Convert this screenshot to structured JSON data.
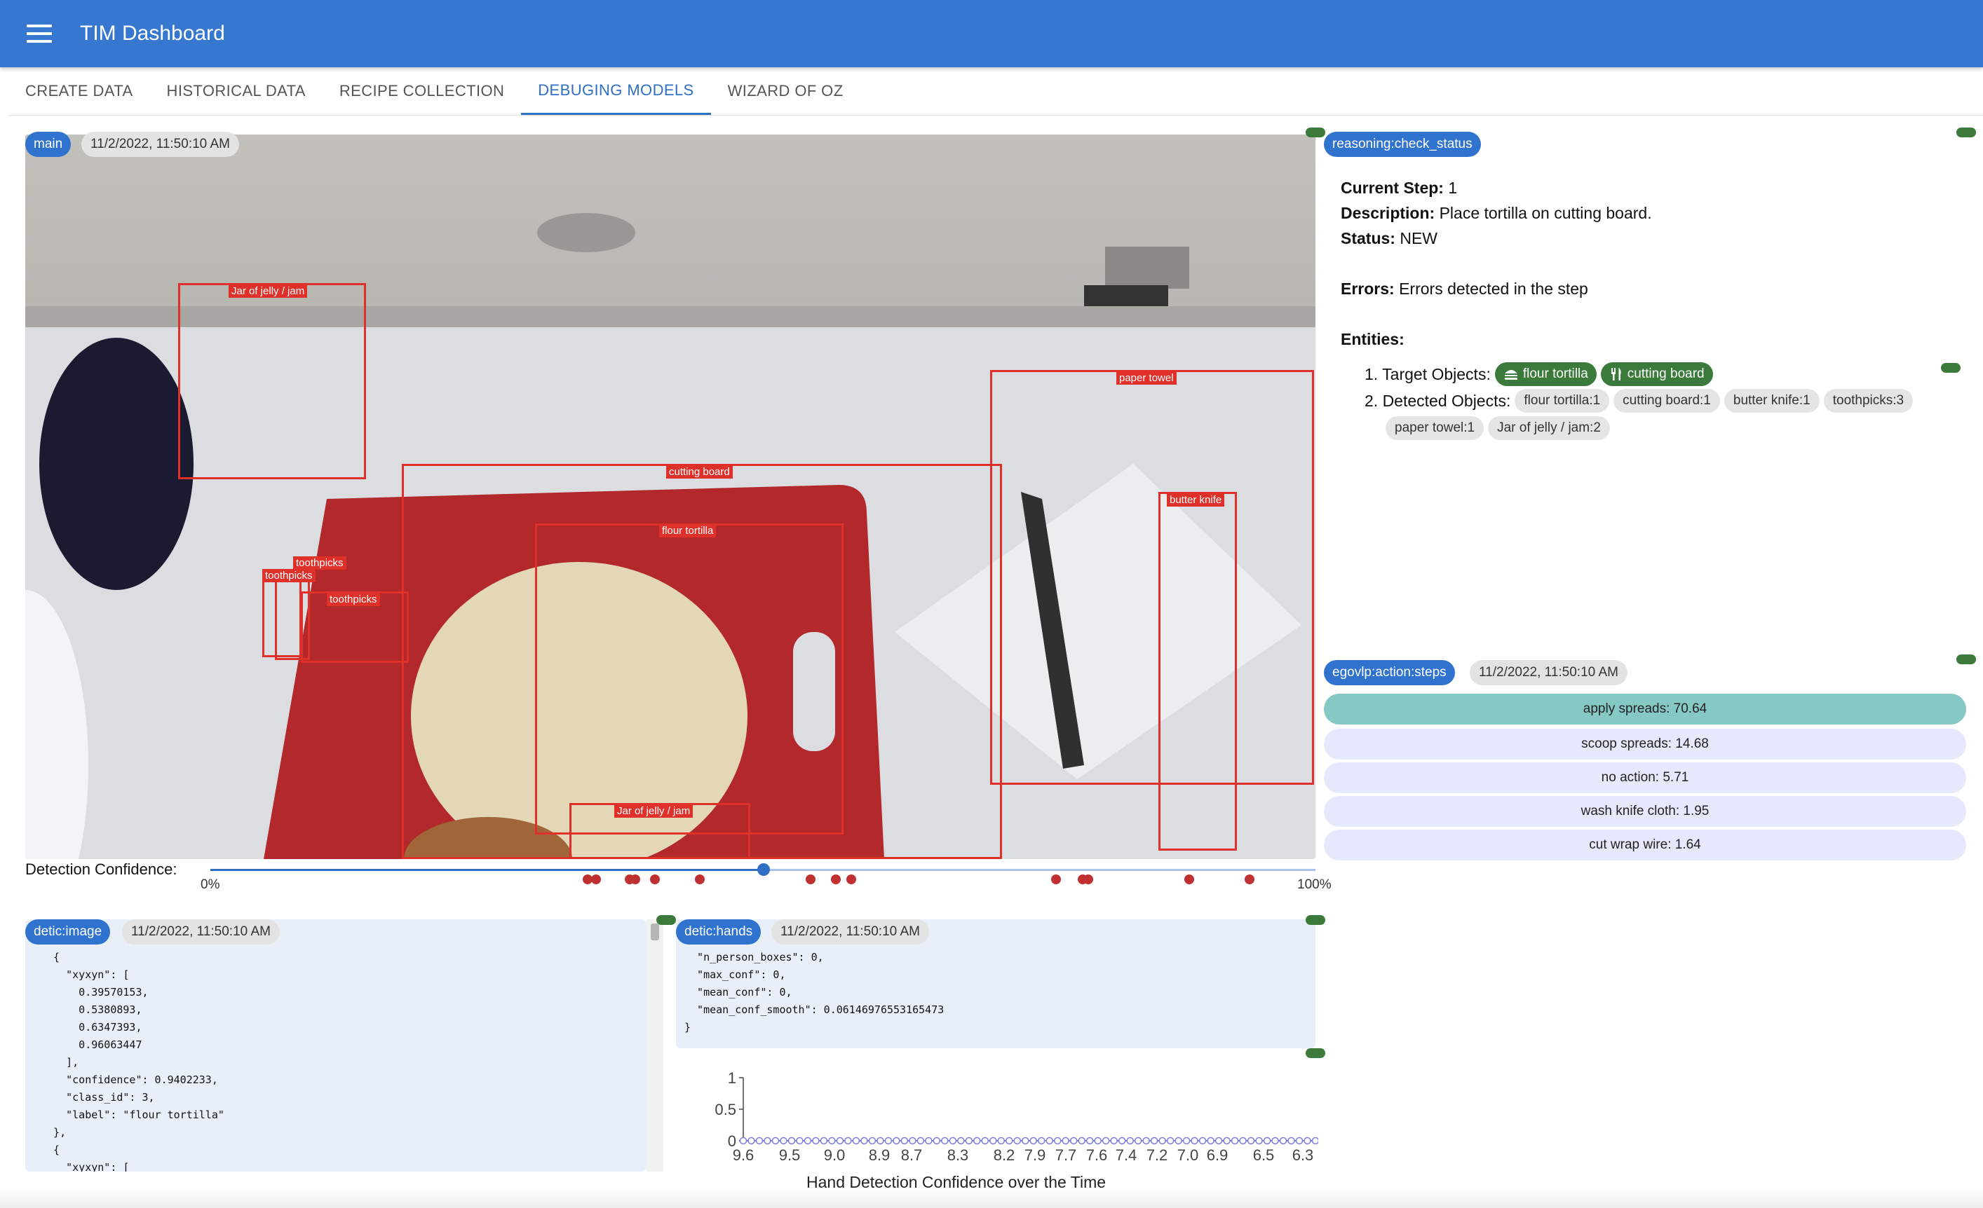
{
  "app": {
    "title": "TIM Dashboard"
  },
  "tabs": [
    {
      "label": "CREATE DATA"
    },
    {
      "label": "HISTORICAL DATA"
    },
    {
      "label": "RECIPE COLLECTION"
    },
    {
      "label": "DEBUGING MODELS"
    },
    {
      "label": "WIZARD OF OZ"
    }
  ],
  "main": {
    "stream": "main",
    "timestamp": "11/2/2022, 11:50:10 AM",
    "detections": [
      {
        "label": "Jar of jelly / jam"
      },
      {
        "label": "paper towel"
      },
      {
        "label": "cutting board"
      },
      {
        "label": "butter knife"
      },
      {
        "label": "flour tortilla"
      },
      {
        "label": "toothpicks"
      },
      {
        "label": "toothpicks"
      },
      {
        "label": "toothpicks"
      },
      {
        "label": "Jar of jelly / jam"
      }
    ],
    "confidence_label": "Detection Confidence:",
    "slider_min": "0%",
    "slider_max": "100%",
    "slider_value": 0.5
  },
  "reasoning": {
    "stream": "reasoning:check_status",
    "current_step_label": "Current Step:",
    "current_step": "1",
    "description_label": "Description:",
    "description": "Place tortilla on cutting board.",
    "status_label": "Status:",
    "status": "NEW",
    "errors_label": "Errors:",
    "errors": "Errors detected in the step",
    "entities_label": "Entities:",
    "target_label": "1. Target Objects:",
    "target_objects": [
      "flour tortilla",
      "cutting board"
    ],
    "detected_label": "2. Detected Objects:",
    "detected_objects": [
      "flour tortilla:1",
      "cutting board:1",
      "butter knife:1",
      "toothpicks:3",
      "paper towel:1",
      "Jar of jelly / jam:2"
    ]
  },
  "egovlp": {
    "stream": "egovlp:action:steps",
    "timestamp": "11/2/2022, 11:50:10 AM",
    "actions": [
      "apply spreads: 70.64",
      "scoop spreads: 14.68",
      "no action: 5.71",
      "wash knife cloth: 1.95",
      "cut wrap wire: 1.64"
    ]
  },
  "detic_image": {
    "stream": "detic:image",
    "timestamp": "11/2/2022, 11:50:10 AM",
    "code": "  {\n    \"xyxyn\": [\n      0.39570153,\n      0.5380893,\n      0.6347393,\n      0.96063447\n    ],\n    \"confidence\": 0.9402233,\n    \"class_id\": 3,\n    \"label\": \"flour tortilla\"\n  },\n  {\n    \"xyxyn\": ["
  },
  "detic_hands": {
    "stream": "detic:hands",
    "timestamp": "11/2/2022, 11:50:10 AM",
    "code": "  \"n_person_boxes\": 0,\n  \"max_conf\": 0,\n  \"mean_conf\": 0,\n  \"mean_conf_smooth\": 0.06146976553165473\n}"
  },
  "chart_data": {
    "type": "line",
    "title": "Hand Detection Confidence over the Time",
    "x": [
      9.6,
      9.5,
      9.0,
      8.9,
      8.7,
      8.3,
      8.2,
      7.9,
      7.7,
      7.6,
      7.4,
      7.2,
      7.0,
      6.9,
      6.5,
      6.3
    ],
    "y_ticks": [
      "1",
      "0.5",
      "0"
    ],
    "ylim": [
      0,
      1
    ],
    "series": [
      {
        "values": [
          0,
          0,
          0,
          0,
          0,
          0,
          0,
          0,
          0,
          0,
          0,
          0,
          0,
          0,
          0,
          0,
          0,
          0,
          0,
          0,
          0,
          0,
          0,
          0,
          0,
          0,
          0,
          0,
          0,
          0,
          0,
          0,
          0,
          0,
          0,
          0,
          0,
          0,
          0,
          0,
          0,
          0,
          0,
          0,
          0,
          0,
          0,
          0,
          0,
          0,
          0,
          0,
          0,
          0,
          0,
          0,
          0,
          0,
          0,
          0,
          0,
          0,
          0,
          0,
          0,
          0,
          0,
          0,
          0,
          0,
          0,
          0
        ]
      }
    ],
    "colors": {
      "line": "#7b7fd6"
    }
  }
}
